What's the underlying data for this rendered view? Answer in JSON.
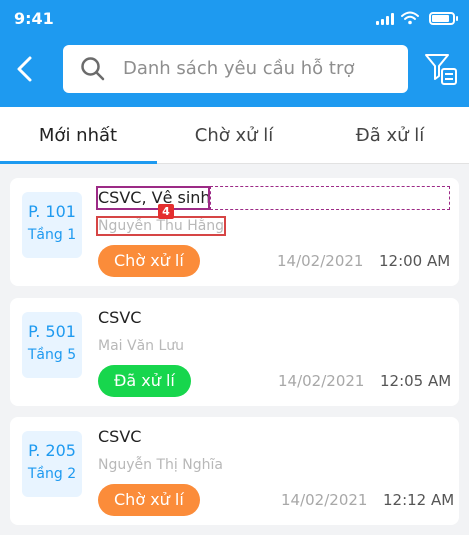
{
  "status_bar": {
    "time": "9:41",
    "battery_level": 0.85
  },
  "header": {
    "search_placeholder": "Danh sách yêu cầu hỗ trợ"
  },
  "tabs": [
    {
      "label": "Mới nhất",
      "active": true
    },
    {
      "label": "Chờ xử lí",
      "active": false
    },
    {
      "label": "Đã xử lí",
      "active": false
    }
  ],
  "colors": {
    "primary": "#1e9af0",
    "pending": "#fb8c3a",
    "done": "#17d64d"
  },
  "requests": [
    {
      "room": "P. 101",
      "floor": "Tầng 1",
      "title": "CSVC, Vệ sinh",
      "person": "Nguyễn Thu Hằng",
      "status": "Chờ xử lí",
      "date": "14/02/2021",
      "time": "12:00 AM"
    },
    {
      "room": "P. 501",
      "floor": "Tầng 5",
      "title": "CSVC",
      "person": "Mai Văn Lưu",
      "status": "Đã xử lí",
      "date": "14/02/2021",
      "time": "12:05 AM"
    },
    {
      "room": "P. 205",
      "floor": "Tầng 2",
      "title": "CSVC",
      "person": "Nguyễn Thị Nghĩa",
      "status": "Chờ xử lí",
      "date": "14/02/2021",
      "time": "12:12 AM"
    }
  ],
  "annotation": {
    "badge": "4"
  }
}
